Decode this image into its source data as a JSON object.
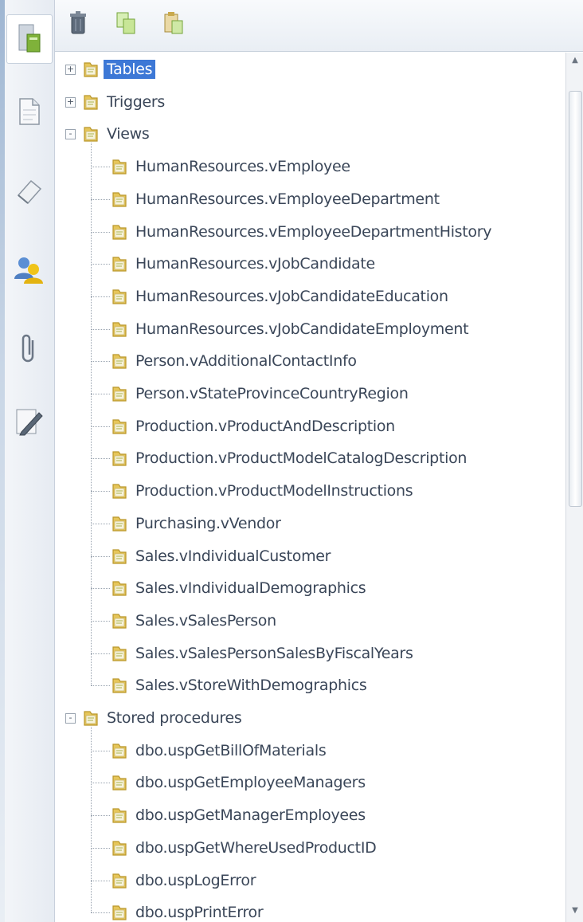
{
  "tree": {
    "nodes": [
      {
        "label": "Tables",
        "level": 0,
        "expander": "+",
        "selected": true
      },
      {
        "label": "Triggers",
        "level": 0,
        "expander": "+"
      },
      {
        "label": "Views",
        "level": 0,
        "expander": "-"
      },
      {
        "label": "HumanResources.vEmployee",
        "level": 1
      },
      {
        "label": "HumanResources.vEmployeeDepartment",
        "level": 1
      },
      {
        "label": "HumanResources.vEmployeeDepartmentHistory",
        "level": 1
      },
      {
        "label": "HumanResources.vJobCandidate",
        "level": 1
      },
      {
        "label": "HumanResources.vJobCandidateEducation",
        "level": 1
      },
      {
        "label": "HumanResources.vJobCandidateEmployment",
        "level": 1
      },
      {
        "label": "Person.vAdditionalContactInfo",
        "level": 1
      },
      {
        "label": "Person.vStateProvinceCountryRegion",
        "level": 1
      },
      {
        "label": "Production.vProductAndDescription",
        "level": 1
      },
      {
        "label": "Production.vProductModelCatalogDescription",
        "level": 1
      },
      {
        "label": "Production.vProductModelInstructions",
        "level": 1
      },
      {
        "label": "Purchasing.vVendor",
        "level": 1
      },
      {
        "label": "Sales.vIndividualCustomer",
        "level": 1
      },
      {
        "label": "Sales.vIndividualDemographics",
        "level": 1
      },
      {
        "label": "Sales.vSalesPerson",
        "level": 1
      },
      {
        "label": "Sales.vSalesPersonSalesByFiscalYears",
        "level": 1
      },
      {
        "label": "Sales.vStoreWithDemographics",
        "level": 1
      },
      {
        "label": "Stored procedures",
        "level": 0,
        "expander": "-"
      },
      {
        "label": "dbo.uspGetBillOfMaterials",
        "level": 1
      },
      {
        "label": "dbo.uspGetEmployeeManagers",
        "level": 1
      },
      {
        "label": "dbo.uspGetManagerEmployees",
        "level": 1
      },
      {
        "label": "dbo.uspGetWhereUsedProductID",
        "level": 1
      },
      {
        "label": "dbo.uspLogError",
        "level": 1
      },
      {
        "label": "dbo.uspPrintError",
        "level": 1
      }
    ]
  },
  "colors": {
    "selection": "#3d78d6",
    "folder": "#e6c65a",
    "folder_dark": "#b9962a"
  },
  "icons": {
    "toolbar": [
      "delete-icon",
      "copy-icon",
      "paste-icon"
    ],
    "leftbar": [
      "database-icon",
      "document-icon",
      "eraser-icon",
      "users-icon",
      "attach-icon",
      "edit-icon"
    ],
    "node": "folder-icon"
  }
}
